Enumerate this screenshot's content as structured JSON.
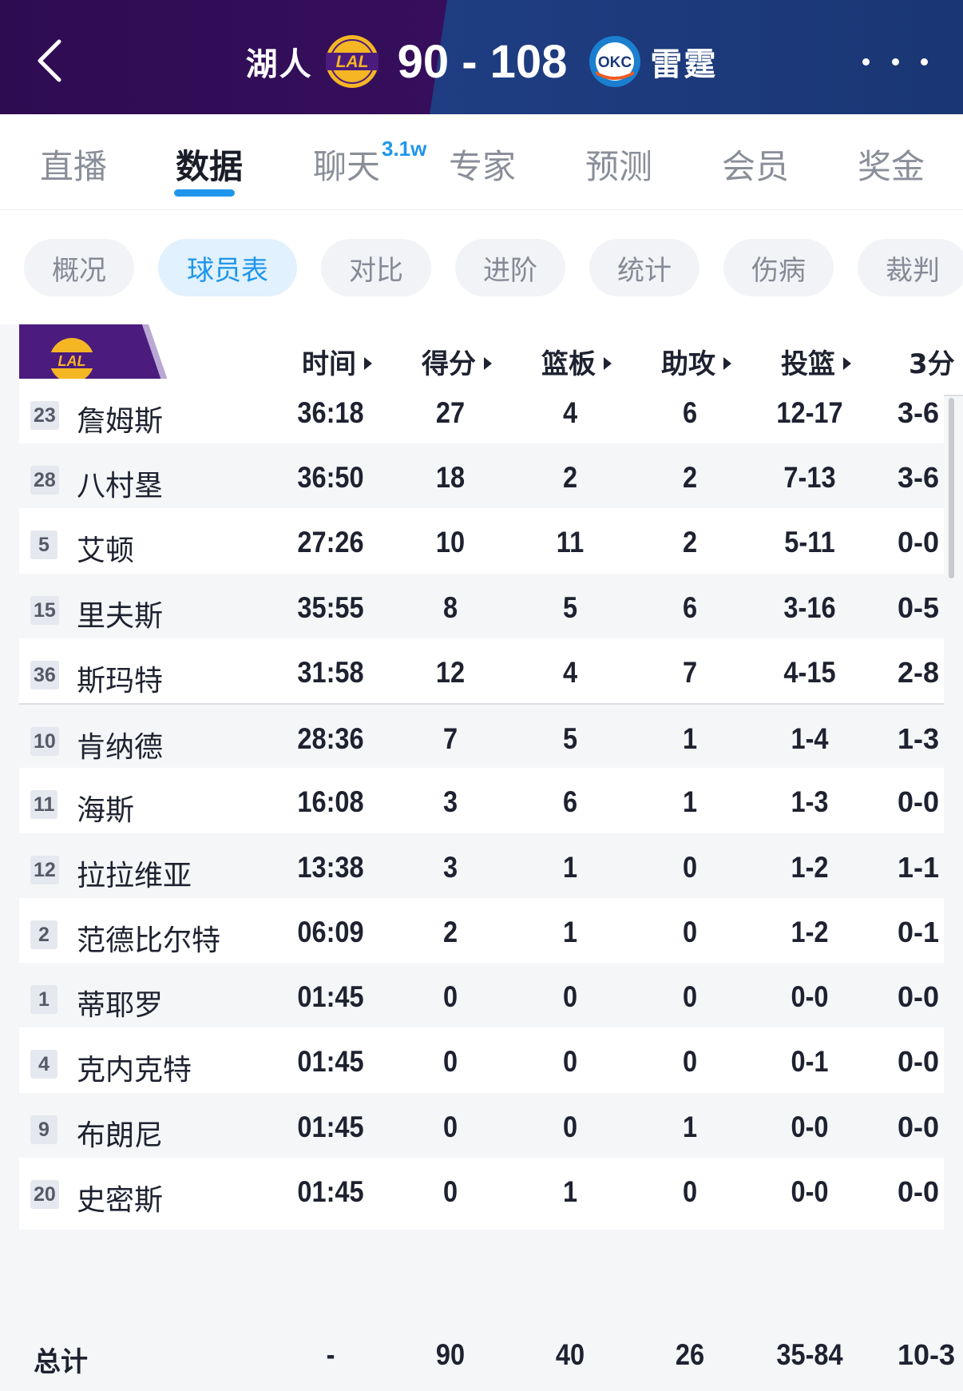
{
  "header": {
    "home_team": "湖人",
    "home_logo_text": "LAL",
    "score": "90 - 108",
    "away_logo_text": "OKC",
    "away_team": "雷霆",
    "colors": {
      "home_purple": "#3a0f63",
      "away_blue": "#1d3a7a",
      "logo_gold": "#f5b624",
      "okc_blue": "#1b7fd0",
      "okc_orange": "#ef5a22"
    }
  },
  "tabs": [
    {
      "label": "直播"
    },
    {
      "label": "数据",
      "active": true
    },
    {
      "label": "聊天",
      "badge": "3.1w"
    },
    {
      "label": "专家"
    },
    {
      "label": "预测"
    },
    {
      "label": "会员"
    },
    {
      "label": "奖金"
    }
  ],
  "subtabs": [
    {
      "label": "概况"
    },
    {
      "label": "球员表",
      "active": true
    },
    {
      "label": "对比"
    },
    {
      "label": "进阶"
    },
    {
      "label": "统计"
    },
    {
      "label": "伤病"
    },
    {
      "label": "裁判"
    }
  ],
  "table": {
    "team_logo_text": "LAL",
    "columns": [
      "时间",
      "得分",
      "篮板",
      "助攻",
      "投篮",
      "3分"
    ],
    "rows": [
      {
        "num": "23",
        "name": "詹姆斯",
        "time": "36:18",
        "pts": "27",
        "reb": "4",
        "ast": "6",
        "fg": "12-17",
        "tp": "3-6"
      },
      {
        "num": "28",
        "name": "八村塁",
        "time": "36:50",
        "pts": "18",
        "reb": "2",
        "ast": "2",
        "fg": "7-13",
        "tp": "3-6"
      },
      {
        "num": "5",
        "name": "艾顿",
        "time": "27:26",
        "pts": "10",
        "reb": "11",
        "ast": "2",
        "fg": "5-11",
        "tp": "0-0"
      },
      {
        "num": "15",
        "name": "里夫斯",
        "time": "35:55",
        "pts": "8",
        "reb": "5",
        "ast": "6",
        "fg": "3-16",
        "tp": "0-5"
      },
      {
        "num": "36",
        "name": "斯玛特",
        "time": "31:58",
        "pts": "12",
        "reb": "4",
        "ast": "7",
        "fg": "4-15",
        "tp": "2-8"
      },
      {
        "num": "10",
        "name": "肯纳德",
        "time": "28:36",
        "pts": "7",
        "reb": "5",
        "ast": "1",
        "fg": "1-4",
        "tp": "1-3"
      },
      {
        "num": "11",
        "name": "海斯",
        "time": "16:08",
        "pts": "3",
        "reb": "6",
        "ast": "1",
        "fg": "1-3",
        "tp": "0-0"
      },
      {
        "num": "12",
        "name": "拉拉维亚",
        "time": "13:38",
        "pts": "3",
        "reb": "1",
        "ast": "0",
        "fg": "1-2",
        "tp": "1-1"
      },
      {
        "num": "2",
        "name": "范德比尔特",
        "time": "06:09",
        "pts": "2",
        "reb": "1",
        "ast": "0",
        "fg": "1-2",
        "tp": "0-1"
      },
      {
        "num": "1",
        "name": "蒂耶罗",
        "time": "01:45",
        "pts": "0",
        "reb": "0",
        "ast": "0",
        "fg": "0-0",
        "tp": "0-0"
      },
      {
        "num": "4",
        "name": "克内克特",
        "time": "01:45",
        "pts": "0",
        "reb": "0",
        "ast": "0",
        "fg": "0-1",
        "tp": "0-0"
      },
      {
        "num": "9",
        "name": "布朗尼",
        "time": "01:45",
        "pts": "0",
        "reb": "0",
        "ast": "1",
        "fg": "0-0",
        "tp": "0-0"
      },
      {
        "num": "20",
        "name": "史密斯",
        "time": "01:45",
        "pts": "0",
        "reb": "1",
        "ast": "0",
        "fg": "0-0",
        "tp": "0-0"
      }
    ],
    "total": {
      "label": "总计",
      "time": "-",
      "pts": "90",
      "reb": "40",
      "ast": "26",
      "fg": "35-84",
      "tp": "10-3"
    }
  }
}
